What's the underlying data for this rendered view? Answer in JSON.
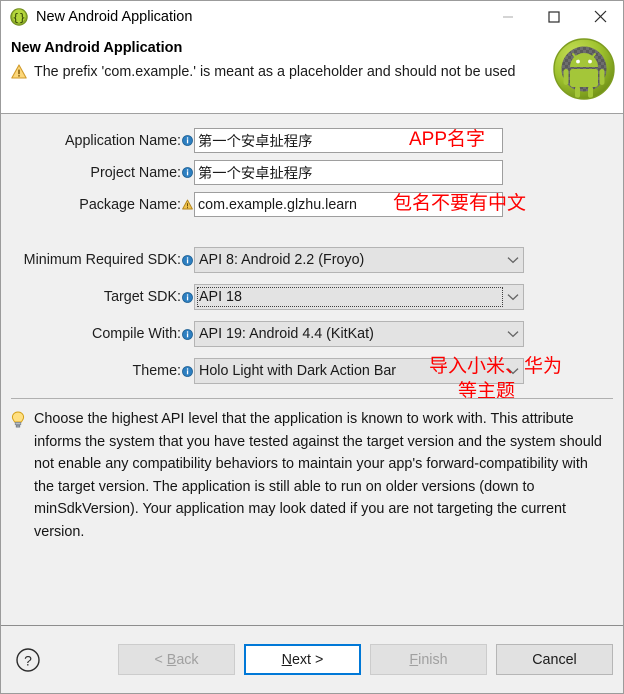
{
  "window": {
    "title": "New Android Application",
    "title_icon": "braces-circle-icon",
    "minimize_label": "Minimize",
    "maximize_label": "Maximize",
    "close_label": "Close"
  },
  "header": {
    "title": "New Android Application",
    "warning_icon": "warning-triangle-icon",
    "message": "The prefix 'com.example.' is meant as a placeholder and should not be used",
    "logo_icon": "android-robot-icon"
  },
  "form": {
    "fields": [
      {
        "label": "Application Name:",
        "icon": "info-icon",
        "value": "第一个安卓扯程序",
        "type": "text"
      },
      {
        "label": "Project Name:",
        "icon": "info-icon",
        "value": "第一个安卓扯程序",
        "type": "text"
      },
      {
        "label": "Package Name:",
        "icon": "warning-icon",
        "value": "com.example.glzhu.learn",
        "type": "text"
      }
    ],
    "combos": [
      {
        "label": "Minimum Required SDK:",
        "icon": "info-icon",
        "value": "API 8: Android 2.2 (Froyo)",
        "focused": false
      },
      {
        "label": "Target SDK:",
        "icon": "info-icon",
        "value": "API 18",
        "focused": true
      },
      {
        "label": "Compile With:",
        "icon": "info-icon",
        "value": "API 19: Android 4.4 (KitKat)",
        "focused": false
      },
      {
        "label": "Theme:",
        "icon": "info-icon",
        "value": "Holo Light with Dark Action Bar",
        "focused": false
      }
    ]
  },
  "annotations": [
    {
      "text": "APP名字",
      "color": "#fe0000"
    },
    {
      "text": "包名不要有中文",
      "color": "#fe0000"
    },
    {
      "text": "导入小米、华为",
      "color": "#fe0000"
    },
    {
      "text": "等主题",
      "color": "#fe0000"
    }
  ],
  "help": {
    "icon": "lightbulb-icon",
    "text": "Choose the highest API level that the application is known to work with. This attribute informs the system that you have tested against the target version and the system should not enable any compatibility behaviors to maintain your app's forward-compatibility with the target version. The application is still able to run on older versions (down to minSdkVersion). Your application may look dated if you are not targeting the current version."
  },
  "footer": {
    "help_icon": "question-mark-icon",
    "buttons": [
      {
        "label": "< Back",
        "state": "disabled",
        "mnemonic": "B"
      },
      {
        "label": "Next >",
        "state": "focused",
        "mnemonic": "N"
      },
      {
        "label": "Finish",
        "state": "disabled",
        "mnemonic": "F"
      },
      {
        "label": "Cancel",
        "state": "enabled",
        "mnemonic": ""
      }
    ]
  },
  "colors": {
    "focus_blue": "#0078d7",
    "annotation_red": "#fe0000",
    "android_green": "#a4c639",
    "warning_amber": "#e8a33d",
    "dialog_gray": "#f0f0f0"
  }
}
